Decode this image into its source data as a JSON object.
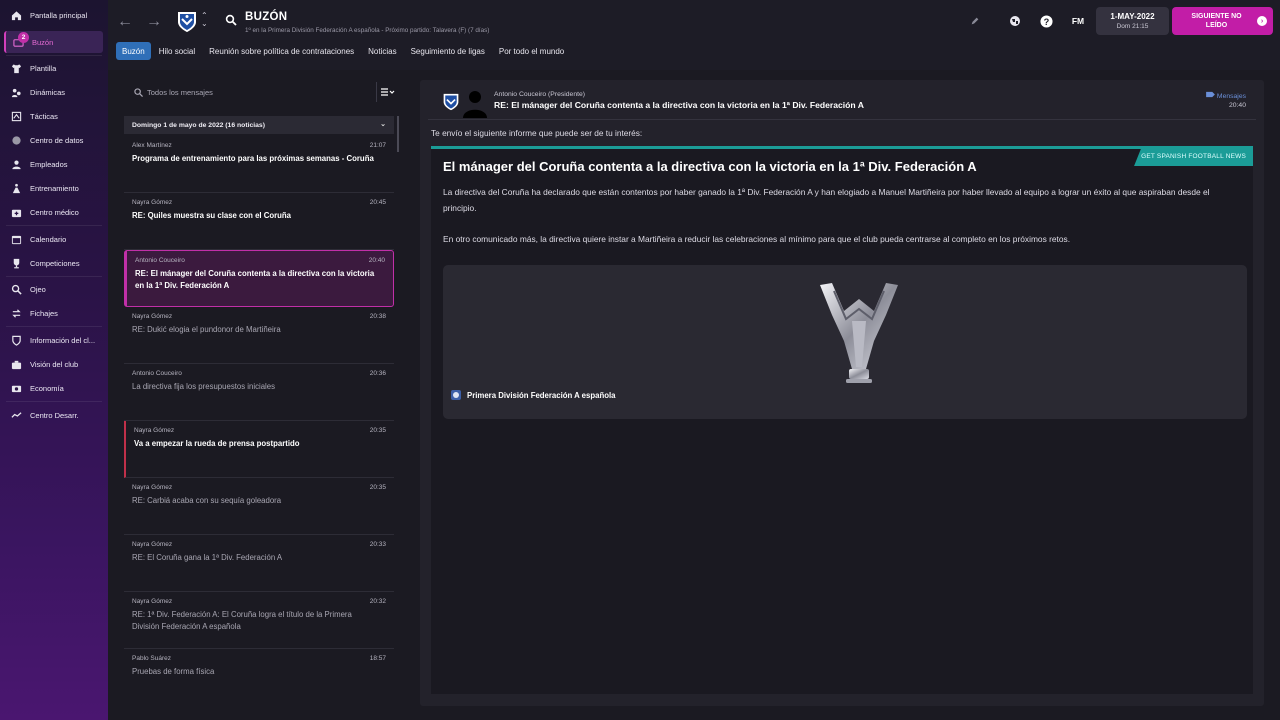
{
  "sidebar": {
    "items": [
      {
        "label": "Pantalla principal",
        "icon": "home-icon"
      },
      {
        "label": "Buzón",
        "icon": "inbox-icon",
        "badge": "2"
      },
      {
        "label": "Plantilla",
        "icon": "shirt-icon"
      },
      {
        "label": "Dinámicas",
        "icon": "dynamics-icon"
      },
      {
        "label": "Tácticas",
        "icon": "tactics-icon"
      },
      {
        "label": "Centro de datos",
        "icon": "data-icon"
      },
      {
        "label": "Empleados",
        "icon": "staff-icon"
      },
      {
        "label": "Entrenamiento",
        "icon": "training-icon"
      },
      {
        "label": "Centro médico",
        "icon": "medical-icon"
      },
      {
        "label": "Calendario",
        "icon": "calendar-icon"
      },
      {
        "label": "Competiciones",
        "icon": "trophy-icon"
      },
      {
        "label": "Ojeo",
        "icon": "scouting-icon"
      },
      {
        "label": "Fichajes",
        "icon": "transfers-icon"
      },
      {
        "label": "Información del cl...",
        "icon": "club-info-icon"
      },
      {
        "label": "Visión del club",
        "icon": "club-vision-icon"
      },
      {
        "label": "Economía",
        "icon": "finances-icon"
      },
      {
        "label": "Centro Desarr.",
        "icon": "development-icon"
      }
    ]
  },
  "header": {
    "title": "BUZÓN",
    "subtitle": "1º en la Primera División Federación A española - Próximo partido: Talavera (F)  (7 días)",
    "fm_label": "FM",
    "date": "1-MAY-2022",
    "date_sub": "Dom 21:15",
    "next_button": "SIGUIENTE NO LEÍDO"
  },
  "tabs": [
    "Buzón",
    "Hilo social",
    "Reunión sobre política de contrataciones",
    "Noticias",
    "Seguimiento de ligas",
    "Por todo el mundo"
  ],
  "inbox": {
    "search_placeholder": "Todos los mensajes",
    "day_header": "Domingo 1 de mayo de 2022 (16 noticias)",
    "messages": [
      {
        "from": "Alex Martínez",
        "time": "21:07",
        "subject": "Programa de entrenamiento para las próximas semanas - Coruña",
        "state": "unread"
      },
      {
        "from": "Nayra Gómez",
        "time": "20:45",
        "subject": "RE: Quiles muestra su clase con el Coruña",
        "state": "unread"
      },
      {
        "from": "Antonio Couceiro",
        "time": "20:40",
        "subject": "RE: El mánager del Coruña contenta a la directiva con la victoria en la 1ª Div. Federación A",
        "state": "selected"
      },
      {
        "from": "Nayra Gómez",
        "time": "20:38",
        "subject": "RE: Dukić elogia el pundonor de Martiñeira",
        "state": "read"
      },
      {
        "from": "Antonio Couceiro",
        "time": "20:36",
        "subject": "La directiva fija los presupuestos iniciales",
        "state": "read"
      },
      {
        "from": "Nayra Gómez",
        "time": "20:35",
        "subject": "Va a empezar la rueda de prensa postpartido",
        "state": "flag"
      },
      {
        "from": "Nayra Gómez",
        "time": "20:35",
        "subject": "RE: Carbiá acaba con su sequía goleadora",
        "state": "read"
      },
      {
        "from": "Nayra Gómez",
        "time": "20:33",
        "subject": "RE: El Coruña gana la 1ª Div. Federación A",
        "state": "read"
      },
      {
        "from": "Nayra Gómez",
        "time": "20:32",
        "subject": "RE: 1ª Div. Federación A: El Coruña logra el título de la Primera División Federación A española",
        "state": "read"
      },
      {
        "from": "Pablo Suárez",
        "time": "18:57",
        "subject": "Pruebas de forma física",
        "state": "read"
      }
    ]
  },
  "reader": {
    "from": "Antonio Couceiro  (Presidente)",
    "subject": "RE: El mánager del Coruña contenta a la directiva con la victoria en la 1ª Div. Federación A",
    "link": "Mensajes",
    "time": "20:40",
    "intro": "Te envío el siguiente informe que puede ser de tu interés:",
    "article": {
      "tag": "GET SPANISH FOOTBALL NEWS",
      "title": "El mánager del Coruña contenta a la directiva con la victoria en la 1ª Div. Federación A",
      "p1": "La directiva del Coruña ha declarado que están contentos por haber ganado la 1ª Div. Federación A y han elogiado a Manuel Martiñeira por haber llevado al equipo a lograr un éxito al que aspiraban desde el principio.",
      "p2": "En otro comunicado más, la directiva quiere instar a Martiñeira a reducir las celebraciones al mínimo para que el club pueda centrarse al completo en los próximos retos.",
      "competition": "Primera División Federación A española"
    }
  },
  "colors": {
    "accent": "#c21da7",
    "tab_active": "#2f6fb8",
    "news_teal": "#1b9c97"
  }
}
